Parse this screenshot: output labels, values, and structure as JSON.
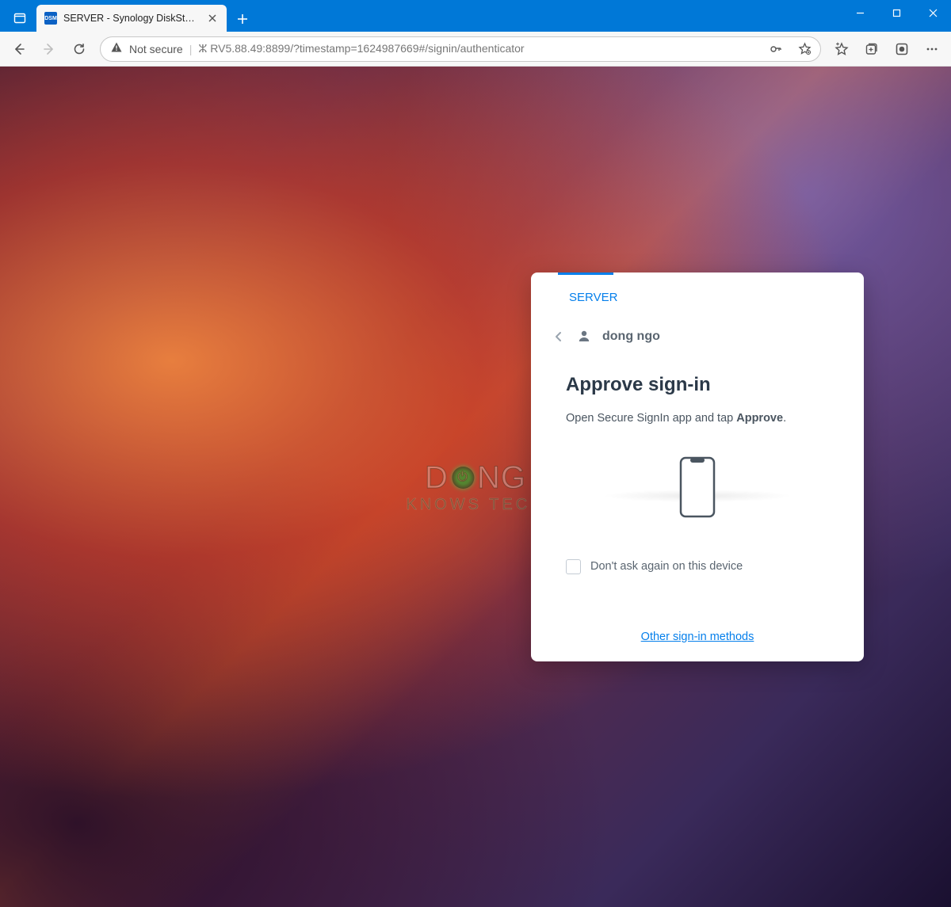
{
  "window": {
    "tab_title": "SERVER - Synology DiskStation",
    "favicon_text": "DSM"
  },
  "toolbar": {
    "security_label": "Not secure",
    "url_display": "ⵣ RV5.88.49:8899/?timestamp=1624987669#/signin/authenticator"
  },
  "watermark": {
    "line1_left": "D",
    "line1_right": "NG",
    "line2": "KNOWS TECH"
  },
  "signin": {
    "server_name": "SERVER",
    "username": "dong ngo",
    "title": "Approve sign-in",
    "instruction_prefix": "Open Secure SignIn app and tap ",
    "instruction_bold": "Approve",
    "instruction_suffix": ".",
    "remember_label": "Don't ask again on this device",
    "other_methods": "Other sign-in methods"
  }
}
